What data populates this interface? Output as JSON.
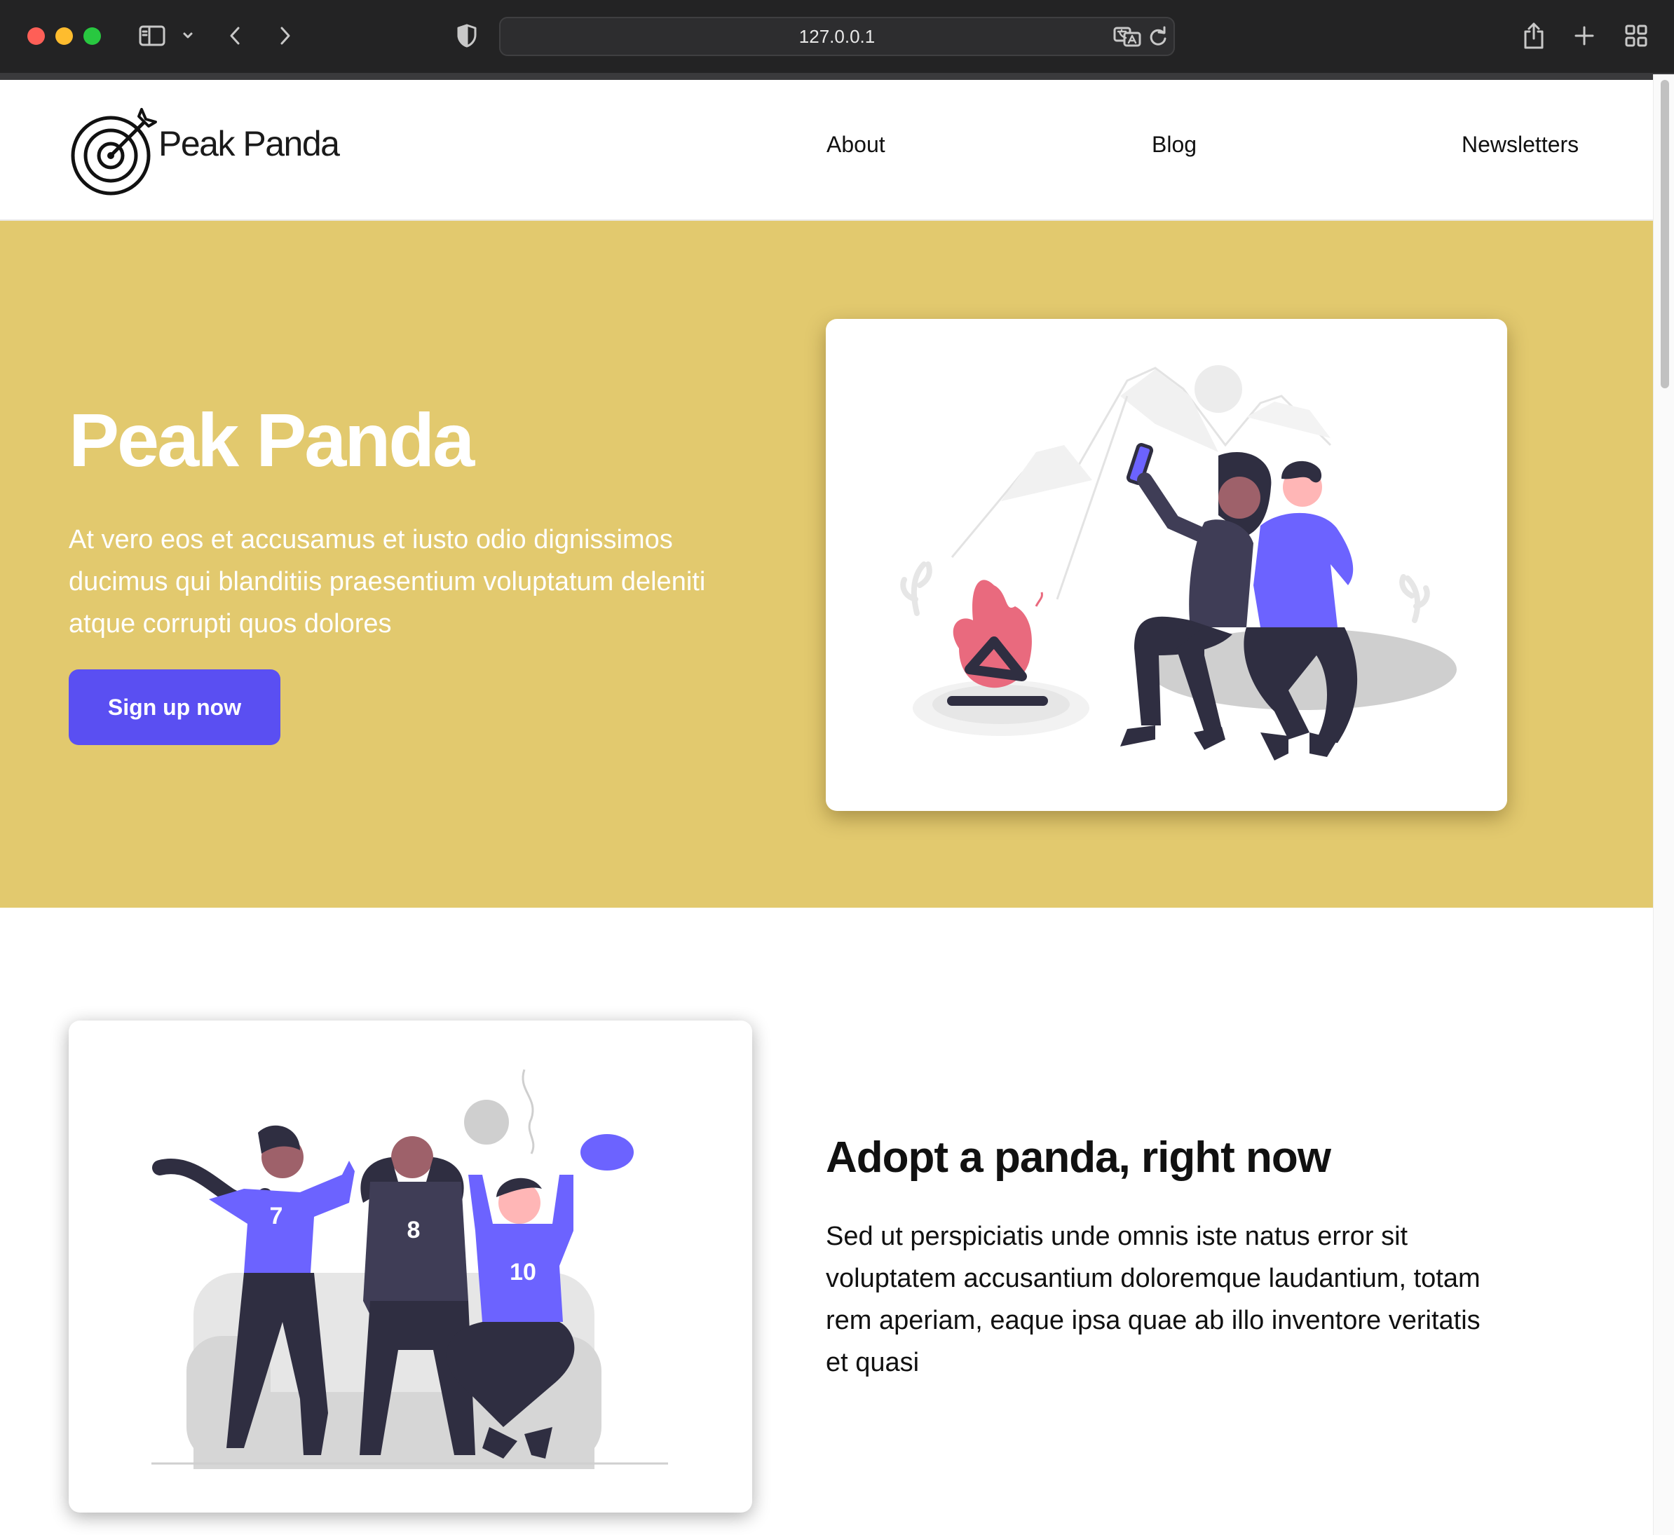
{
  "browser": {
    "url": "127.0.0.1"
  },
  "header": {
    "brand": "Peak Panda",
    "nav": [
      "About",
      "Blog",
      "Newsletters"
    ]
  },
  "hero": {
    "title": "Peak Panda",
    "text": "At vero eos et accusamus et iusto odio dignissimos ducimus qui blanditiis praesentium voluptatum deleniti atque corrupti quos dolores",
    "cta_label": "Sign up now"
  },
  "feature": {
    "title": "Adopt a panda, right now",
    "text": "Sed ut perspiciatis unde omnis iste natus error sit voluptatem accusantium doloremque laudantium, totam rem aperiam, eaque ipsa quae ab illo inventore veritatis et quasi",
    "jersey_numbers": [
      "7",
      "8",
      "10"
    ]
  },
  "colors": {
    "hero_background": "#e2c96e",
    "accent": "#5a4ff2",
    "illustration_primary": "#6c63ff",
    "illustration_dark": "#2f2e41",
    "fire": "#e96a7e"
  },
  "icons": {
    "logo": "target-with-arrow-icon",
    "privacy": "shield-icon",
    "translate": "translate-icon",
    "reload": "reload-icon",
    "share": "share-icon",
    "new_tab": "plus-icon",
    "tab_overview": "grid-icon"
  }
}
